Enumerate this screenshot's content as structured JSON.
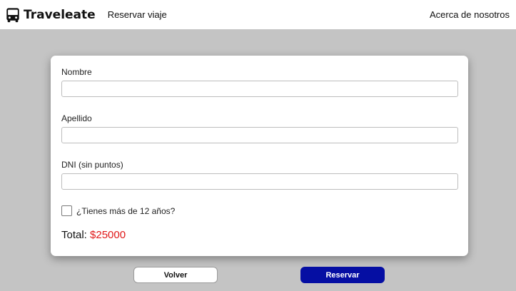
{
  "navbar": {
    "brand": "Traveleate",
    "brand_icon": "bus-icon",
    "links": {
      "reserve": "Reservar viaje",
      "about": "Acerca de nosotros"
    }
  },
  "form": {
    "fields": [
      {
        "label": "Nombre",
        "value": "",
        "placeholder": ""
      },
      {
        "label": "Apellido",
        "value": "",
        "placeholder": ""
      },
      {
        "label": "DNI (sin puntos)",
        "value": "",
        "placeholder": ""
      }
    ],
    "age_checkbox": {
      "label": "¿Tienes más de 12 años?",
      "checked": false
    },
    "total": {
      "label": "Total:",
      "amount": "$25000",
      "amount_color": "#e01818"
    }
  },
  "buttons": {
    "back": "Volver",
    "reserve": "Reservar",
    "reserve_color": "#050ea3"
  },
  "colors": {
    "page_background": "#c4c4c4",
    "card_background": "#ffffff"
  }
}
